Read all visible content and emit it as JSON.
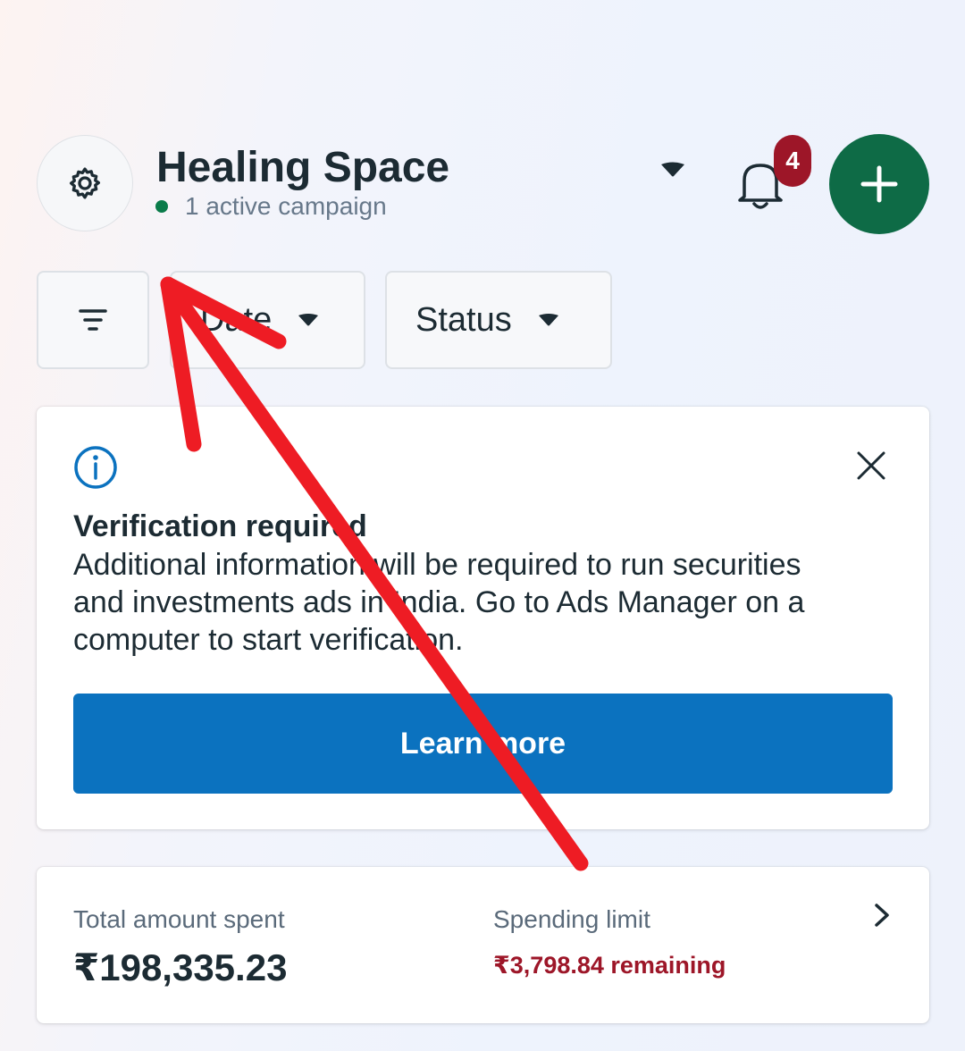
{
  "header": {
    "account_name": "Healing Space",
    "active_campaigns": "1 active campaign",
    "notification_count": "4"
  },
  "filters": {
    "date_label": "Date",
    "status_label": "Status"
  },
  "verification": {
    "title": "Verification required",
    "body": "Additional information will be required to run securities and investments ads in India. Go to Ads Manager on a computer to start verification.",
    "button_label": "Learn more"
  },
  "spend": {
    "total_label": "Total amount spent",
    "total_value": "₹198,335.23",
    "limit_label": "Spending limit",
    "limit_remaining": "₹3,798.84 remaining"
  },
  "icons": [
    "gear-icon",
    "caret-down-icon",
    "bell-icon",
    "plus-icon",
    "filter-icon",
    "info-icon",
    "close-icon",
    "chevron-right-icon"
  ],
  "colors": {
    "primary_button": "#0b72bf",
    "add_button": "#0e6b46",
    "badge": "#9d1628",
    "active_dot": "#0a7b4a",
    "annotation_arrow": "#ee1c24"
  }
}
